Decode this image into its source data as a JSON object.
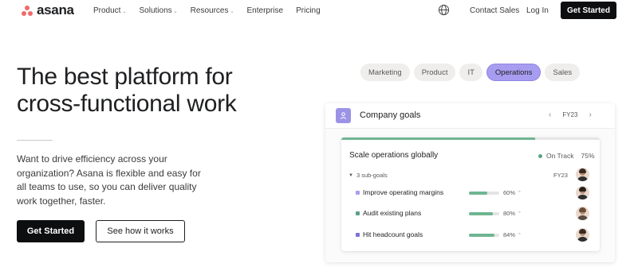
{
  "nav": {
    "logo_text": "asana",
    "menu": [
      {
        "label": "Product",
        "has_chevron": true
      },
      {
        "label": "Solutions",
        "has_chevron": true
      },
      {
        "label": "Resources",
        "has_chevron": true
      },
      {
        "label": "Enterprise",
        "has_chevron": false
      },
      {
        "label": "Pricing",
        "has_chevron": false
      }
    ],
    "contact_sales": "Contact Sales",
    "log_in": "Log In",
    "get_started": "Get Started",
    "globe_icon": "globe-icon"
  },
  "hero": {
    "headline_line1": "The best platform for",
    "headline_line2": "cross-functional work",
    "subtext": "Want to drive efficiency across your organization? Asana is flexible and easy for all teams to use, so you can deliver quality work together, faster.",
    "primary_cta": "Get Started",
    "secondary_cta": "See how it works"
  },
  "tabs": [
    {
      "label": "Marketing",
      "active": false
    },
    {
      "label": "Product",
      "active": false
    },
    {
      "label": "IT",
      "active": false
    },
    {
      "label": "Operations",
      "active": true
    },
    {
      "label": "Sales",
      "active": false
    }
  ],
  "goals_card": {
    "title": "Company goals",
    "fy": "FY23",
    "panel": {
      "title": "Scale operations globally",
      "status": "On Track",
      "percent": "75%",
      "progress": 0.75,
      "subgoals_label": "3 sub-goals",
      "fy": "FY23",
      "rows": [
        {
          "label": "Improve operating margins",
          "percent": "60%",
          "progress": 0.6,
          "dot_color": "#a79df0"
        },
        {
          "label": "Audit existing plans",
          "percent": "80%",
          "progress": 0.8,
          "dot_color": "#5da283"
        },
        {
          "label": "Hit headcount goals",
          "percent": "84%",
          "progress": 0.84,
          "dot_color": "#7a73d6"
        }
      ]
    }
  },
  "colors": {
    "accent": "#a79df0",
    "brand": "#f06a6a",
    "on_track": "#5da283",
    "dark": "#0d0e10"
  }
}
